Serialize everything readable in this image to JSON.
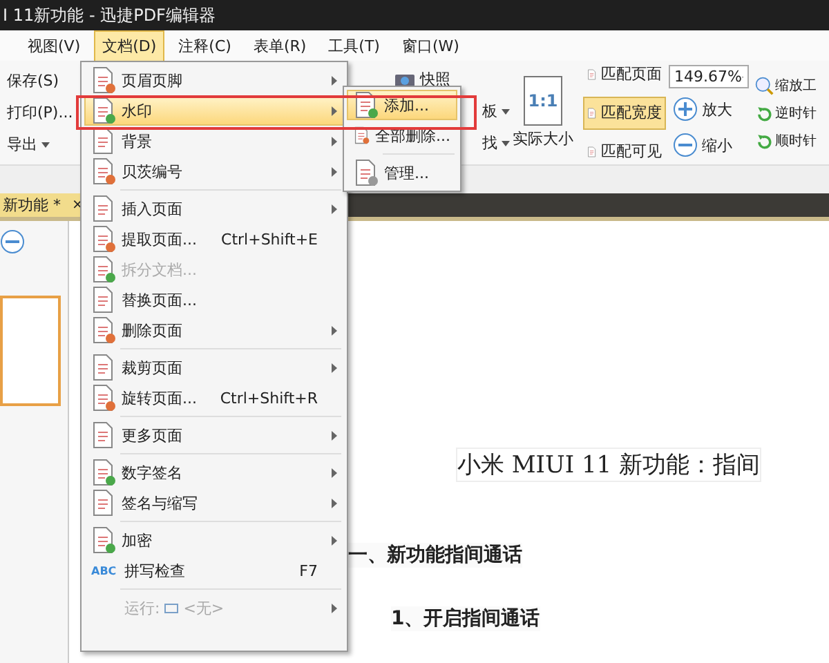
{
  "window": {
    "title": "I 11新功能 - 迅捷PDF编辑器"
  },
  "menu_bar": [
    {
      "label": "视图(V)",
      "selected": false
    },
    {
      "label": "文档(D)",
      "selected": true
    },
    {
      "label": "注释(C)",
      "selected": false
    },
    {
      "label": "表单(R)",
      "selected": false
    },
    {
      "label": "工具(T)",
      "selected": false
    },
    {
      "label": "窗口(W)",
      "selected": false
    }
  ],
  "toolbar": {
    "file_buttons": [
      {
        "label": "保存(S)"
      },
      {
        "label": "打印(P)..."
      },
      {
        "label": "导出",
        "dropdown": true
      }
    ],
    "snapshot": {
      "label": "快照"
    },
    "partial_buttons": [
      {
        "label": "板",
        "dropdown": true
      },
      {
        "label": "找",
        "dropdown": true
      }
    ],
    "actual_size": {
      "icon_text": "1:1",
      "label": "实际大小"
    },
    "fit_buttons": [
      {
        "label": "匹配页面",
        "selected": false
      },
      {
        "label": "匹配宽度",
        "selected": true
      },
      {
        "label": "匹配可见",
        "selected": false
      }
    ],
    "zoom_value": "149.67%",
    "zoom_buttons": [
      {
        "label": "放大",
        "kind": "plus"
      },
      {
        "label": "缩小",
        "kind": "minus"
      }
    ],
    "right_buttons": [
      {
        "label": "缩放工",
        "kind": "magnifier"
      },
      {
        "label": "逆时针",
        "kind": "rotate"
      },
      {
        "label": "顺时针",
        "kind": "rotate"
      }
    ]
  },
  "document_tab": {
    "label": "新功能 *",
    "close": "×"
  },
  "document_menu": {
    "items": [
      {
        "kind": "item",
        "label": "页眉页脚",
        "submenu": true,
        "selected": false,
        "disabled": false
      },
      {
        "kind": "item",
        "label": "水印",
        "submenu": true,
        "selected": true,
        "disabled": false
      },
      {
        "kind": "item",
        "label": "背景",
        "submenu": true,
        "selected": false,
        "disabled": false
      },
      {
        "kind": "item",
        "label": "贝茨编号",
        "submenu": true,
        "selected": false,
        "disabled": false
      },
      {
        "kind": "separator"
      },
      {
        "kind": "item",
        "label": "插入页面",
        "submenu": true,
        "selected": false,
        "disabled": false
      },
      {
        "kind": "item",
        "label": "提取页面...",
        "shortcut": "Ctrl+Shift+E",
        "submenu": false,
        "selected": false,
        "disabled": false
      },
      {
        "kind": "item",
        "label": "拆分文档...",
        "submenu": false,
        "selected": false,
        "disabled": true
      },
      {
        "kind": "item",
        "label": "替换页面...",
        "submenu": false,
        "selected": false,
        "disabled": false
      },
      {
        "kind": "item",
        "label": "删除页面",
        "submenu": true,
        "selected": false,
        "disabled": false
      },
      {
        "kind": "separator"
      },
      {
        "kind": "item",
        "label": "裁剪页面",
        "submenu": true,
        "selected": false,
        "disabled": false
      },
      {
        "kind": "item",
        "label": "旋转页面...",
        "shortcut": "Ctrl+Shift+R",
        "submenu": false,
        "selected": false,
        "disabled": false
      },
      {
        "kind": "separator"
      },
      {
        "kind": "item",
        "label": "更多页面",
        "submenu": true,
        "selected": false,
        "disabled": false
      },
      {
        "kind": "separator"
      },
      {
        "kind": "item",
        "label": "数字签名",
        "submenu": true,
        "selected": false,
        "disabled": false
      },
      {
        "kind": "item",
        "label": "签名与缩写",
        "submenu": true,
        "selected": false,
        "disabled": false
      },
      {
        "kind": "separator"
      },
      {
        "kind": "item",
        "label": "加密",
        "submenu": true,
        "selected": false,
        "disabled": false
      },
      {
        "kind": "item",
        "label": "拼写检查",
        "icon_text": "ABC",
        "shortcut": "F7",
        "submenu": false,
        "selected": false,
        "disabled": false
      },
      {
        "kind": "separator"
      },
      {
        "kind": "run",
        "label": "运行:",
        "value": "<无>",
        "submenu": true,
        "selected": false,
        "disabled": true
      }
    ]
  },
  "watermark_submenu": {
    "items": [
      {
        "kind": "item",
        "label": "添加...",
        "selected": true
      },
      {
        "kind": "item",
        "label": "全部删除...",
        "selected": false
      },
      {
        "kind": "separator"
      },
      {
        "kind": "item",
        "label": "管理...",
        "selected": false
      }
    ]
  },
  "document": {
    "title": "小米 MIUI 11 新功能：指间",
    "heading": "一、新功能指间通话",
    "subheading": "1、开启指间通话"
  }
}
